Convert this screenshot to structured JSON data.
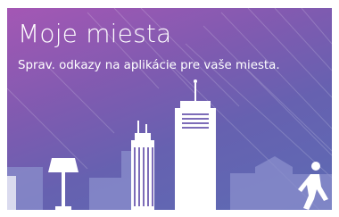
{
  "card": {
    "title": "Moje miesta",
    "subtitle": "Sprav. odkazy na aplikácie pre vaše miesta.",
    "colors": {
      "gradient_top": "#a457b4",
      "gradient_bottom": "#5d6bb4",
      "buildings_back": "#8b8fcd",
      "buildings_front": "#ffffff"
    },
    "icons": [
      "lamp-icon",
      "walking-person-icon",
      "city-skyline-illustration"
    ]
  }
}
